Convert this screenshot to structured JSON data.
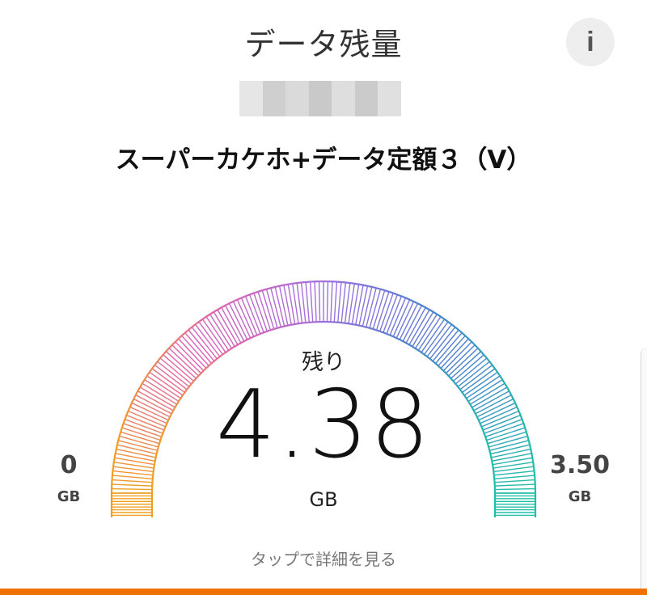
{
  "header": {
    "title": "データ残量",
    "info_icon": "i"
  },
  "account": {
    "mask_colors": [
      "#e6e6e6",
      "#cfcfcf",
      "#dadada",
      "#c9c9c9",
      "#dedede",
      "#cbcbcb",
      "#e0e0e0"
    ]
  },
  "plan": {
    "name": "スーパーカケホ+データ定額３（V）"
  },
  "gauge": {
    "remaining_label": "残り",
    "remaining_value": "4.38",
    "remaining_unit": "GB",
    "min_value": "0",
    "min_unit": "GB",
    "max_value": "3.50",
    "max_unit": "GB",
    "colors": [
      "#f0a020",
      "#e060b0",
      "#a070e0",
      "#4a80d0",
      "#20c0a8"
    ]
  },
  "footer": {
    "detail_link": "タップで詳細を見る",
    "bar_color": "#f07000"
  }
}
